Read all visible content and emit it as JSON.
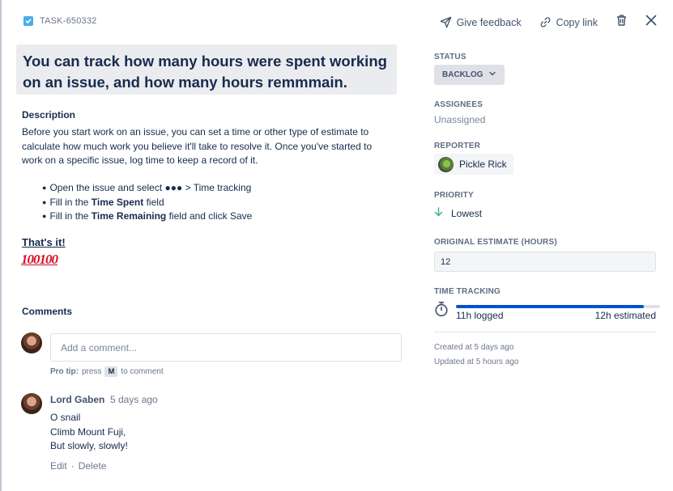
{
  "header": {
    "task_key": "TASK-650332",
    "give_feedback": "Give feedback",
    "copy_link": "Copy link"
  },
  "issue": {
    "title": "You can track how many hours were spent working on an issue, and how many hours remmmain."
  },
  "description": {
    "heading": "Description",
    "text": "Before you start work on an issue, you can set a time or other type of estimate to calculate how much work you believe it'll take to resolve it. Once you've started to work on a specific issue, log time to keep a record of it.",
    "bullet1": "Open the issue and select ●●● > Time tracking",
    "bullet2_prefix": "Fill in the ",
    "bullet2_bold": "Time Spent",
    "bullet2_suffix": " field",
    "bullet3_prefix": "Fill in the ",
    "bullet3_bold": "Time Remaining",
    "bullet3_suffix": " field and click Save",
    "thats_it": "That's it!",
    "emoji": "100100"
  },
  "comments": {
    "heading": "Comments",
    "placeholder": "Add a comment...",
    "protip_label": "Pro tip:",
    "protip_press": "press",
    "protip_key": "M",
    "protip_suffix": "to comment",
    "items": [
      {
        "author": "Lord Gaben",
        "time": "5 days ago",
        "line1": "O snail",
        "line2": "Climb Mount Fuji,",
        "line3": "But slowly, slowly!",
        "edit": "Edit",
        "separator": "·",
        "delete": "Delete"
      }
    ]
  },
  "sidebar": {
    "status_label": "STATUS",
    "status_value": "BACKLOG",
    "assignees_label": "ASSIGNEES",
    "assignees_value": "Unassigned",
    "reporter_label": "REPORTER",
    "reporter_value": "Pickle Rick",
    "priority_label": "PRIORITY",
    "priority_value": "Lowest",
    "priority_color": "#36b37e",
    "estimate_label": "ORIGINAL ESTIMATE (HOURS)",
    "estimate_value": "12",
    "tracking_label": "TIME TRACKING",
    "tracking_logged": "11h logged",
    "tracking_estimated": "12h estimated",
    "tracking_fraction": 0.92,
    "tracking_color": "#0052cc",
    "created": "Created at 5 days ago",
    "updated": "Updated at 5 hours ago"
  },
  "icons": {
    "task_type": "checkbox-icon",
    "feedback": "paper-plane-icon",
    "link": "link-icon",
    "trash": "trash-icon",
    "close": "close-icon",
    "status_dropdown": "chevron-down-icon",
    "priority": "arrow-down-icon",
    "tracking": "stopwatch-icon"
  }
}
